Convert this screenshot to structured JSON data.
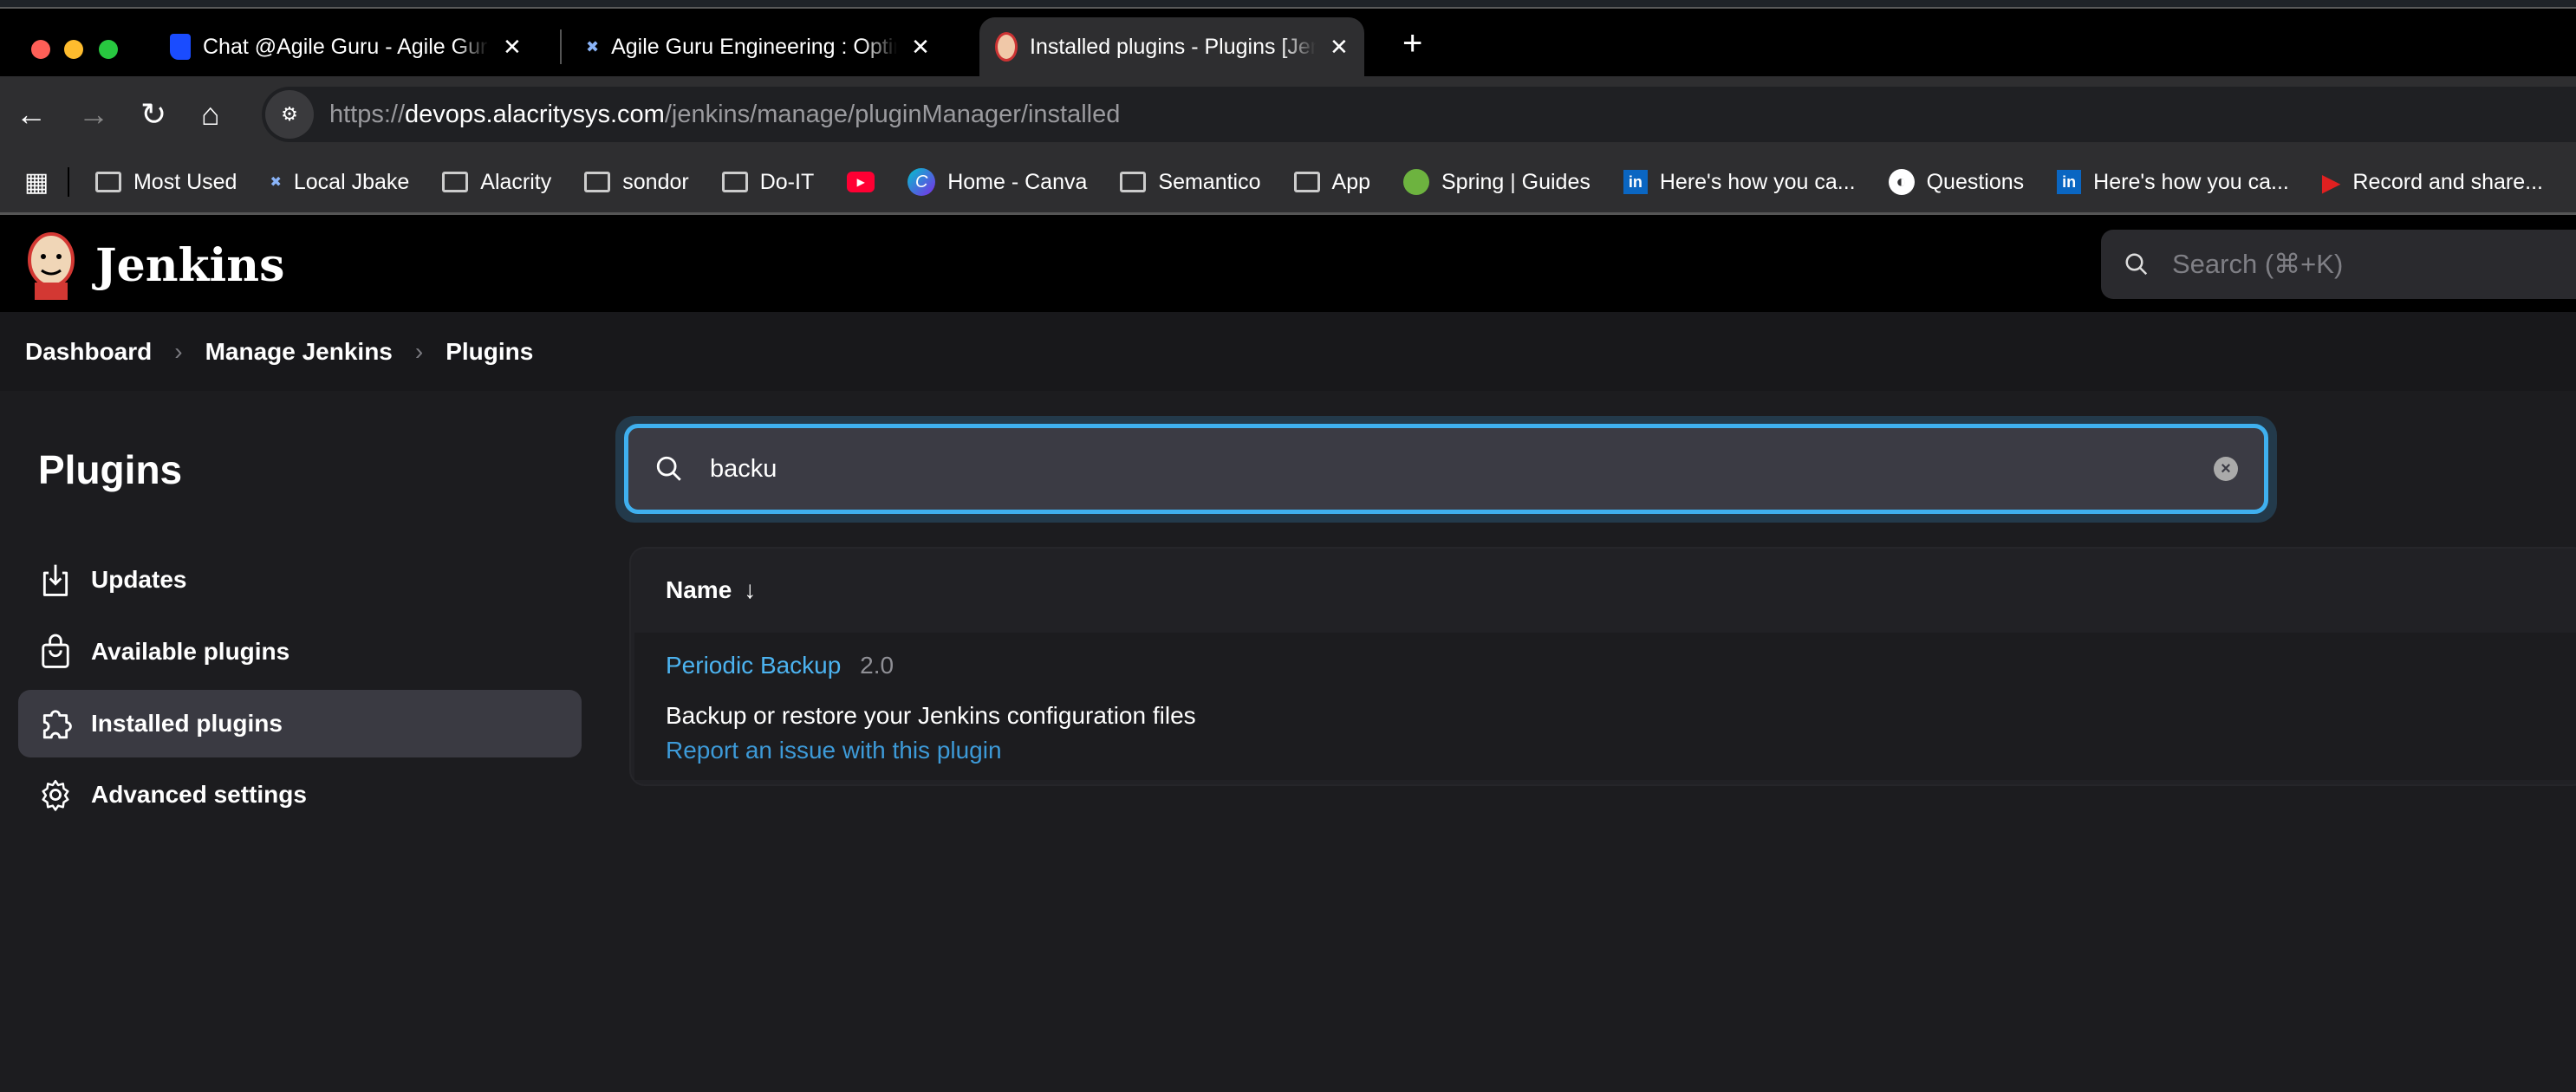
{
  "browser": {
    "tabs": [
      {
        "title": "Chat @Agile Guru - Agile Guru",
        "icon": "chat-icon",
        "close": "✕"
      },
      {
        "title": "Agile Guru Engineering : Optimizing",
        "icon": "jbake-icon",
        "close": "✕"
      },
      {
        "title": "Installed plugins - Plugins [Jenkins]",
        "icon": "jenkins-icon",
        "close": "✕",
        "active": true
      }
    ],
    "new_tab": "+",
    "url_scheme": "https://",
    "url_host": "devops.alacritysys.com",
    "url_path": "/jenkins/manage/pluginManager/installed",
    "bookmarks": [
      {
        "label": "Most Used",
        "icon": "folder-icon"
      },
      {
        "label": "Local Jbake",
        "icon": "jbake-icon"
      },
      {
        "label": "Alacrity",
        "icon": "folder-icon"
      },
      {
        "label": "sondor",
        "icon": "folder-icon"
      },
      {
        "label": "Do-IT",
        "icon": "folder-icon"
      },
      {
        "label": "",
        "icon": "youtube-icon"
      },
      {
        "label": "Home - Canva",
        "icon": "canva-icon"
      },
      {
        "label": "Semantico",
        "icon": "folder-icon"
      },
      {
        "label": "App",
        "icon": "folder-icon"
      },
      {
        "label": "Spring | Guides",
        "icon": "spring-icon"
      },
      {
        "label": "Here's how you ca...",
        "icon": "linkedin-icon"
      },
      {
        "label": "Questions",
        "icon": "globe-icon"
      },
      {
        "label": "Here's how you ca...",
        "icon": "linkedin-icon"
      },
      {
        "label": "Record and share...",
        "icon": "record-icon"
      }
    ]
  },
  "header": {
    "brand": "Jenkins",
    "search_placeholder": "Search (⌘+K)"
  },
  "breadcrumb": [
    "Dashboard",
    "Manage Jenkins",
    "Plugins"
  ],
  "sidebar": {
    "title": "Plugins",
    "items": [
      {
        "label": "Updates",
        "icon": "download-icon"
      },
      {
        "label": "Available plugins",
        "icon": "shopping-bag-icon"
      },
      {
        "label": "Installed plugins",
        "icon": "puzzle-icon",
        "active": true
      },
      {
        "label": "Advanced settings",
        "icon": "gear-icon"
      }
    ]
  },
  "main": {
    "search_value": "backu",
    "table": {
      "name_header": "Name",
      "sort": "↓",
      "rows": [
        {
          "name": "Periodic Backup",
          "version": "2.0",
          "description": "Backup or restore your Jenkins configuration files",
          "report_link": "Report an issue with this plugin"
        }
      ]
    }
  },
  "colors": {
    "accent": "#3fb0ef",
    "link": "#4aa8e8"
  }
}
